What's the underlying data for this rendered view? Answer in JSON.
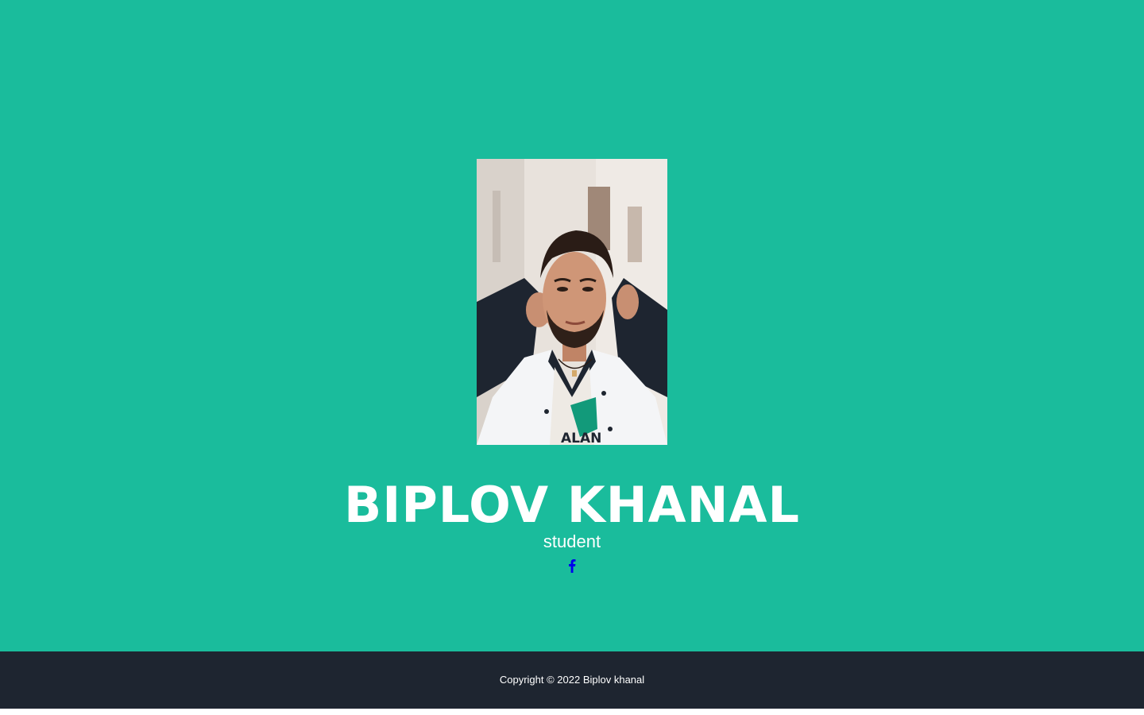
{
  "profile": {
    "name": "BIPLOV KHANAL",
    "role": "student",
    "photo_alt": "profile-photo"
  },
  "social": {
    "facebook_icon": "facebook-icon"
  },
  "footer": {
    "copyright": "Copyright © 2022 Biplov khanal"
  },
  "colors": {
    "hero_background": "#1abc9c",
    "footer_background": "#1e2530",
    "text": "#ffffff",
    "facebook_icon": "#0000ee"
  }
}
